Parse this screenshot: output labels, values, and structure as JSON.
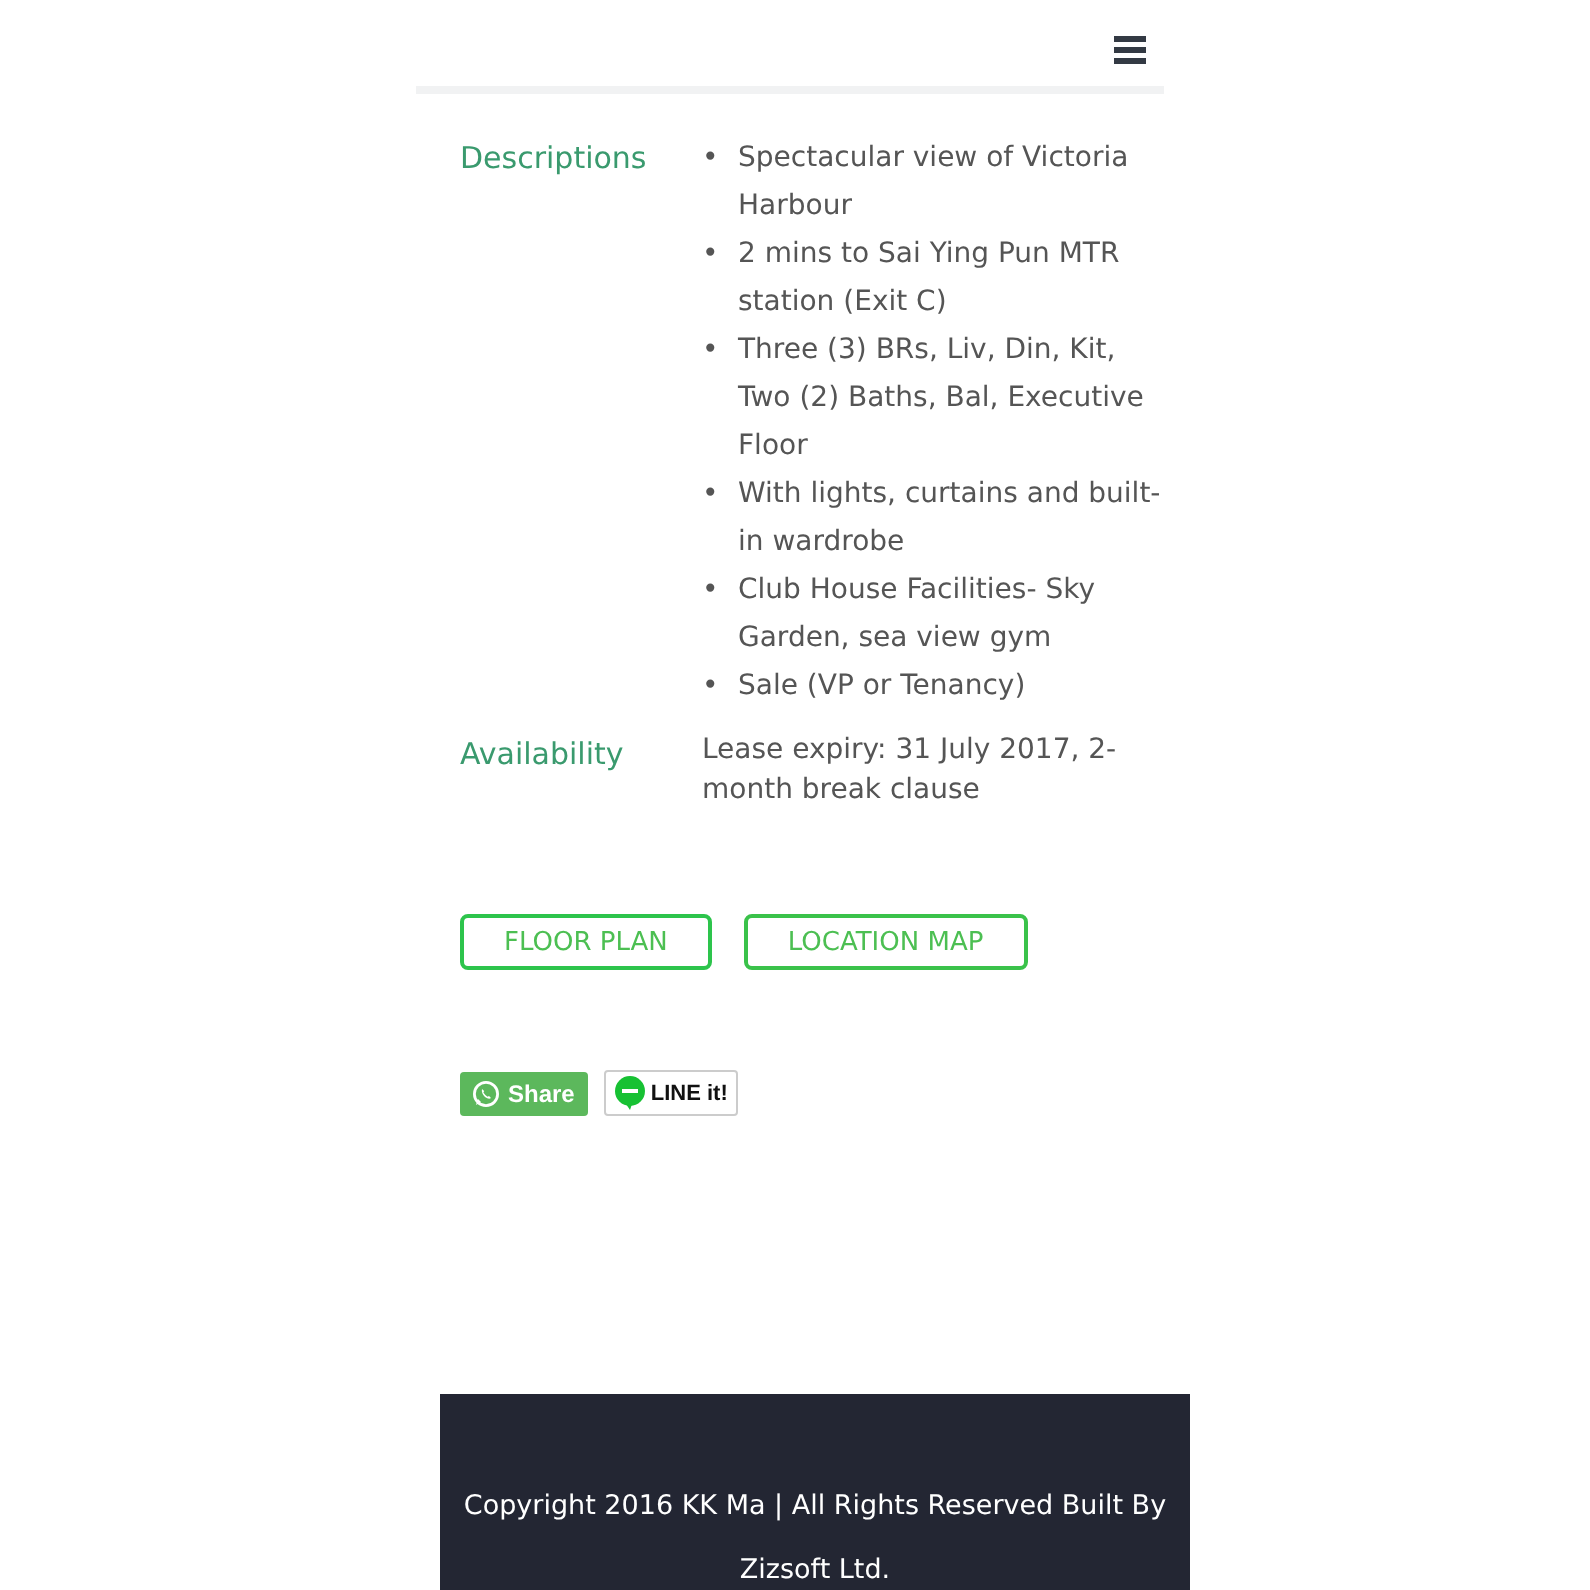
{
  "details": [
    {
      "kind": "list",
      "label": "Descriptions",
      "bullet": "•",
      "items": [
        "Spectacular view of Victoria Harbour",
        "2 mins to Sai Ying Pun MTR station (Exit C)",
        "Three (3) BRs, Liv, Din, Kit, Two (2) Baths, Bal, Executive Floor",
        "With lights, curtains and built-in wardrobe",
        "Club House Facilities- Sky Garden, sea view gym",
        "Sale (VP or Tenancy)"
      ]
    },
    {
      "kind": "text",
      "label": "Availability",
      "text": "Lease expiry: 31 July 2017, 2-month break clause"
    }
  ],
  "buttons": [
    "FLOOR PLAN",
    "LOCATION MAP"
  ],
  "share": [
    {
      "kind": "whatsapp",
      "label": "Share"
    },
    {
      "kind": "line",
      "label": "LINE it!"
    }
  ],
  "footer": "Copyright 2016 KK Ma | All Rights Reserved Built By Zizsoft Ltd."
}
